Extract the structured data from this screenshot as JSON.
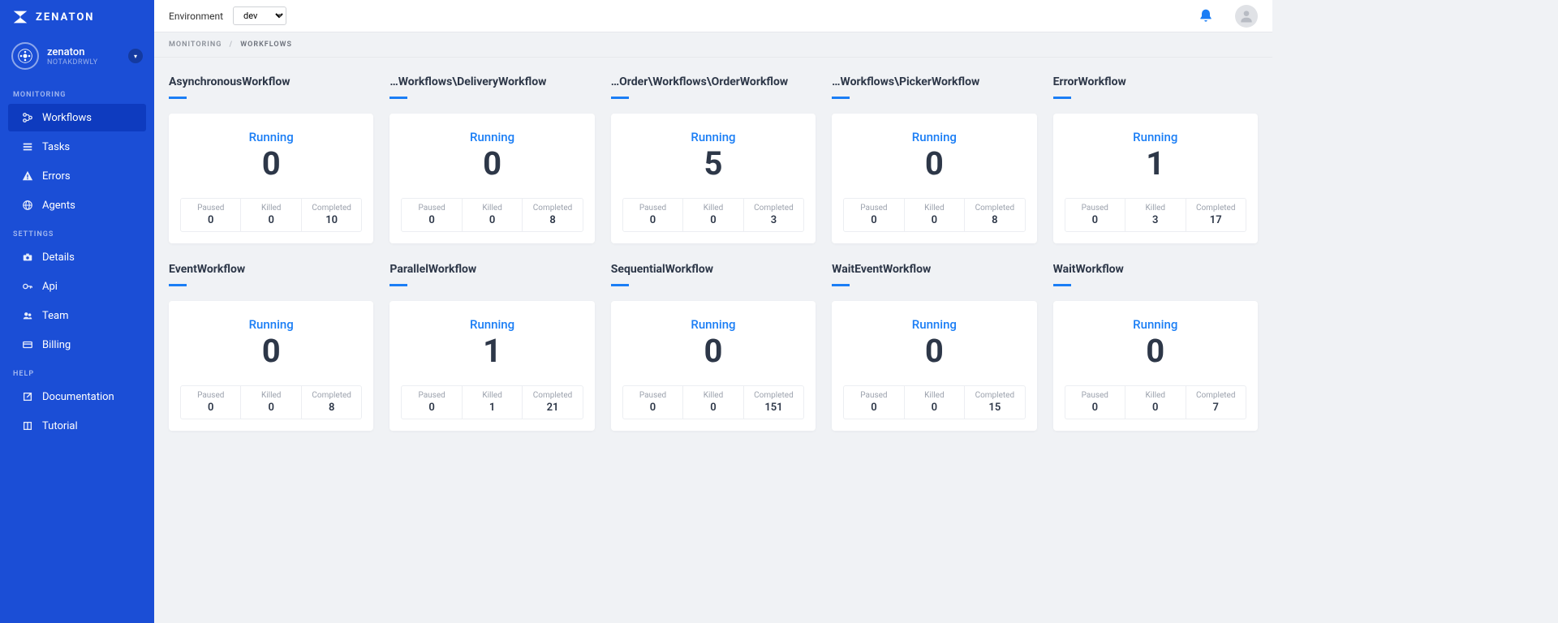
{
  "brand": "ZENATON",
  "org": {
    "name": "zenaton",
    "sub": "NOTAKDRWLY"
  },
  "sidebar": {
    "sections": {
      "monitoring": {
        "label": "MONITORING",
        "items": [
          {
            "label": "Workflows",
            "icon": "branch"
          },
          {
            "label": "Tasks",
            "icon": "list"
          },
          {
            "label": "Errors",
            "icon": "alert"
          },
          {
            "label": "Agents",
            "icon": "globe"
          }
        ]
      },
      "settings": {
        "label": "SETTINGS",
        "items": [
          {
            "label": "Details",
            "icon": "camera"
          },
          {
            "label": "Api",
            "icon": "key"
          },
          {
            "label": "Team",
            "icon": "team"
          },
          {
            "label": "Billing",
            "icon": "card"
          }
        ]
      },
      "help": {
        "label": "HELP",
        "items": [
          {
            "label": "Documentation",
            "icon": "external"
          },
          {
            "label": "Tutorial",
            "icon": "book"
          }
        ]
      }
    }
  },
  "topbar": {
    "env_label": "Environment",
    "env_value": "dev"
  },
  "breadcrumb": {
    "a": "MONITORING",
    "b": "WORKFLOWS"
  },
  "labels": {
    "running": "Running",
    "paused": "Paused",
    "killed": "Killed",
    "completed": "Completed"
  },
  "workflows": [
    {
      "title": "AsynchronousWorkflow",
      "running": "0",
      "paused": "0",
      "killed": "0",
      "completed": "10"
    },
    {
      "title": "…Workflows\\DeliveryWorkflow",
      "running": "0",
      "paused": "0",
      "killed": "0",
      "completed": "8"
    },
    {
      "title": "…Order\\Workflows\\OrderWorkflow",
      "running": "5",
      "paused": "0",
      "killed": "0",
      "completed": "3"
    },
    {
      "title": "…Workflows\\PickerWorkflow",
      "running": "0",
      "paused": "0",
      "killed": "0",
      "completed": "8"
    },
    {
      "title": "ErrorWorkflow",
      "running": "1",
      "paused": "0",
      "killed": "3",
      "completed": "17"
    },
    {
      "title": "EventWorkflow",
      "running": "0",
      "paused": "0",
      "killed": "0",
      "completed": "8"
    },
    {
      "title": "ParallelWorkflow",
      "running": "1",
      "paused": "0",
      "killed": "1",
      "completed": "21"
    },
    {
      "title": "SequentialWorkflow",
      "running": "0",
      "paused": "0",
      "killed": "0",
      "completed": "151"
    },
    {
      "title": "WaitEventWorkflow",
      "running": "0",
      "paused": "0",
      "killed": "0",
      "completed": "15"
    },
    {
      "title": "WaitWorkflow",
      "running": "0",
      "paused": "0",
      "killed": "0",
      "completed": "7"
    }
  ]
}
